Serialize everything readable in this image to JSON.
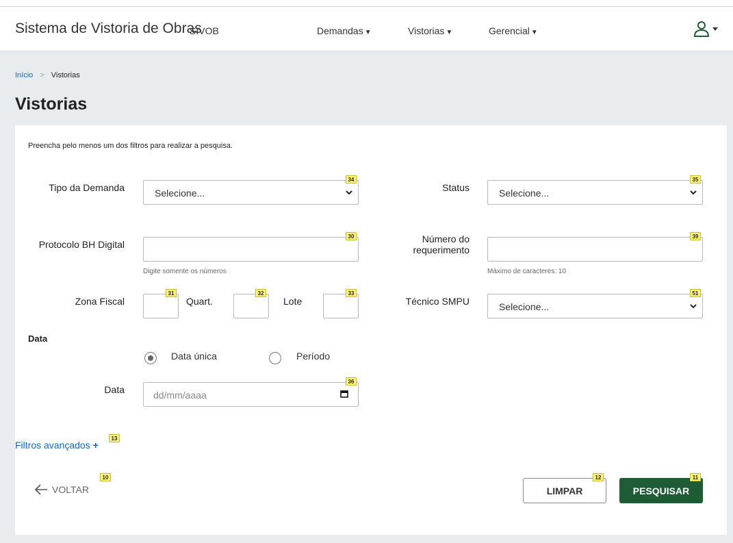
{
  "header": {
    "app_title": "Sistema de Vistoria de Obras",
    "app_abbr": "SIVOB",
    "nav": [
      {
        "label": "Demandas"
      },
      {
        "label": "Vistorias"
      },
      {
        "label": "Gerencial"
      }
    ],
    "user_icon": "user-icon"
  },
  "breadcrumb": {
    "home": "Início",
    "separator": ">",
    "current": "Vistorias"
  },
  "page_title": "Vistorias",
  "form": {
    "instruction": "Preencha pelo menos um dos filtros para realizar a pesquisa.",
    "tipo_demanda": {
      "label": "Tipo da Demanda",
      "value": "Selecione...",
      "badge": "34"
    },
    "status": {
      "label": "Status",
      "value": "Selecione...",
      "badge": "35"
    },
    "protocolo": {
      "label": "Protocolo BH Digital",
      "value": "",
      "hint": "Digite somente os números",
      "badge": "30"
    },
    "numero_requerimento": {
      "label_line1": "Número do",
      "label_line2": "requerimento",
      "value": "",
      "hint": "Máximo de caracteres: 10",
      "badge": "39"
    },
    "zona_fiscal": {
      "label": "Zona Fiscal",
      "badge": "31"
    },
    "quart": {
      "label": "Quart.",
      "badge": "32"
    },
    "lote": {
      "label": "Lote",
      "badge": "33"
    },
    "tecnico": {
      "label": "Técnico SMPU",
      "value": "Selecione...",
      "badge": "51"
    },
    "data_section": "Data",
    "radio_unica": {
      "label": "Data única",
      "checked": true
    },
    "radio_periodo": {
      "label": "Período",
      "checked": false
    },
    "data": {
      "label": "Data",
      "placeholder": "dd/mm/aaaa",
      "badge": "36"
    }
  },
  "advanced": {
    "label": "Filtros avançados",
    "plus": "+",
    "badge": "13"
  },
  "actions": {
    "back": {
      "label": "VOLTAR",
      "badge": "10"
    },
    "clear": {
      "label": "LIMPAR",
      "badge": "12"
    },
    "search": {
      "label": "PESQUISAR",
      "badge": "11"
    }
  },
  "colors": {
    "primary_button": "#1e5c35",
    "link": "#1565c0",
    "badge_bg": "#fff37a",
    "page_bg": "#e9ecee"
  }
}
